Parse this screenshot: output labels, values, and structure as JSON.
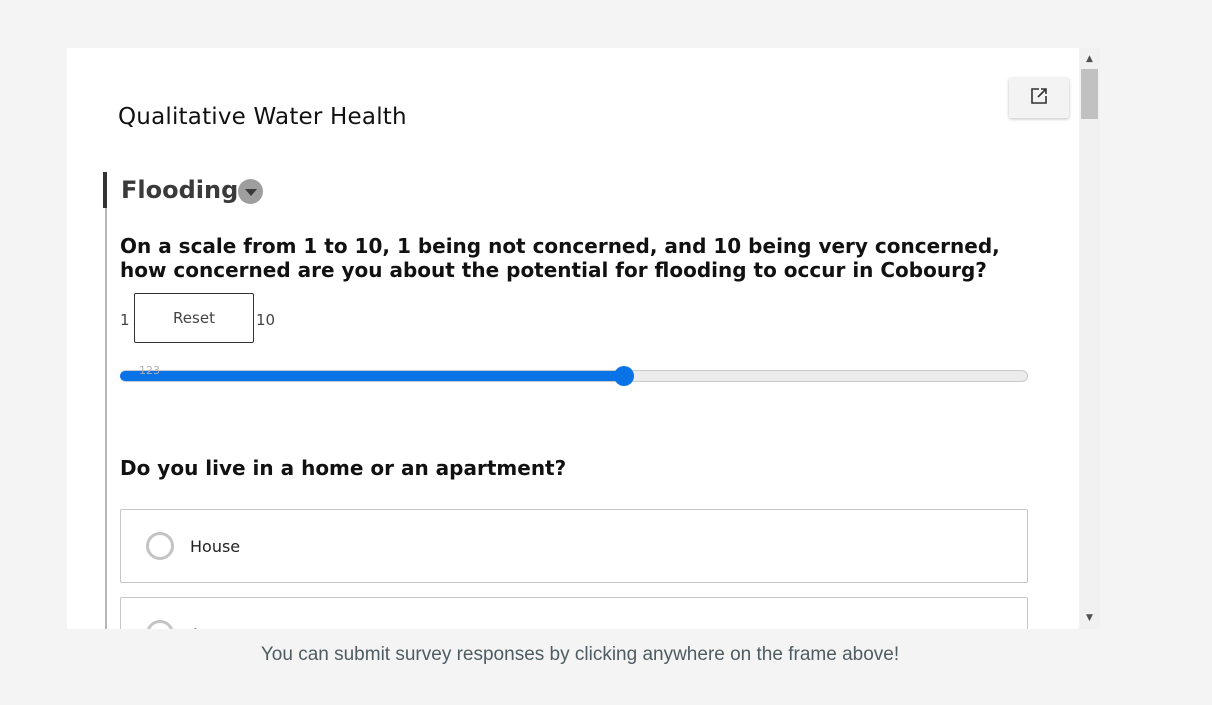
{
  "form": {
    "title": "Qualitative Water Health"
  },
  "section": {
    "title": "Flooding",
    "toggle_icon": "chevron-down-icon",
    "popout_icon": "external-link-icon"
  },
  "question1": {
    "text": "On a scale from 1 to 10, 1 being not concerned, and 10 being very concerned, how concerned are you about the potential for flooding to occur in Cobourg?",
    "min_label": "1",
    "max_label": "10",
    "reset_label": "Reset",
    "slider_ticks": "123",
    "slider_value_fraction": 0.555,
    "accent_color": "#0a73e8"
  },
  "question2": {
    "text": "Do you live in a home or an apartment?",
    "choices": [
      {
        "label": "House"
      },
      {
        "label": "A"
      }
    ]
  },
  "footer": {
    "text": "You can submit survey responses by clicking anywhere on the frame above!"
  }
}
